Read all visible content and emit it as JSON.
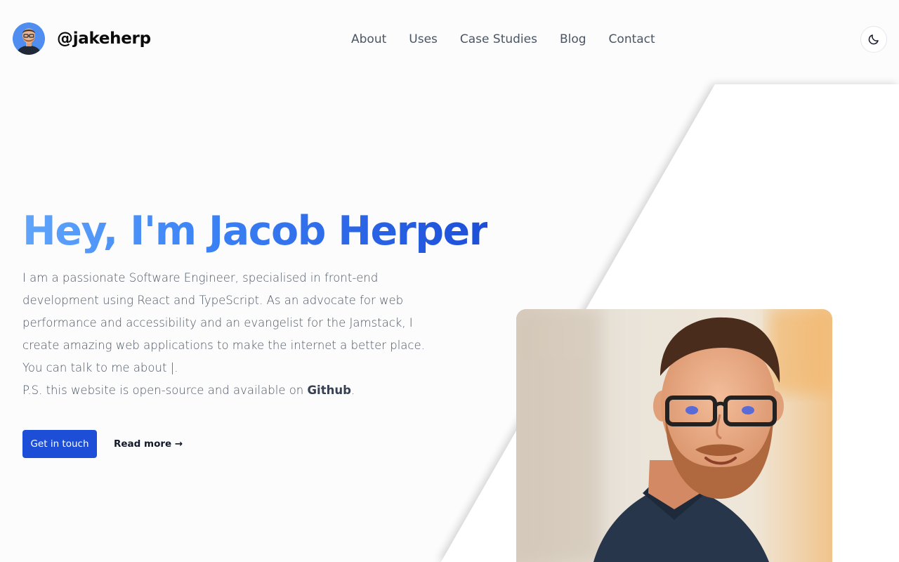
{
  "header": {
    "brand_name": "@jakeherp",
    "nav": [
      "About",
      "Uses",
      "Case Studies",
      "Blog",
      "Contact"
    ]
  },
  "hero": {
    "title": "Hey, I'm Jacob Herper",
    "paragraph_1": "I am a passionate Software Engineer, specialised in front-end development using React and TypeScript. As an advocate for web performance and accessibility and an evangelist for the Jamstack, I create amazing web applications to make the internet a better place.",
    "talk_prefix": "You can talk to me about",
    "talk_cursor": "|.",
    "ps_prefix": "P.S. this website is open-source and available on ",
    "ps_link": "Github",
    "ps_suffix": ".",
    "cta_primary": "Get in touch",
    "cta_secondary": "Read more →"
  },
  "icons": {
    "theme_toggle": "moon-icon"
  },
  "colors": {
    "accent": "#1d4ed8",
    "title_gradient_start": "#60a5fa",
    "title_gradient_end": "#1d4ed8",
    "background": "#fcfcfd"
  }
}
